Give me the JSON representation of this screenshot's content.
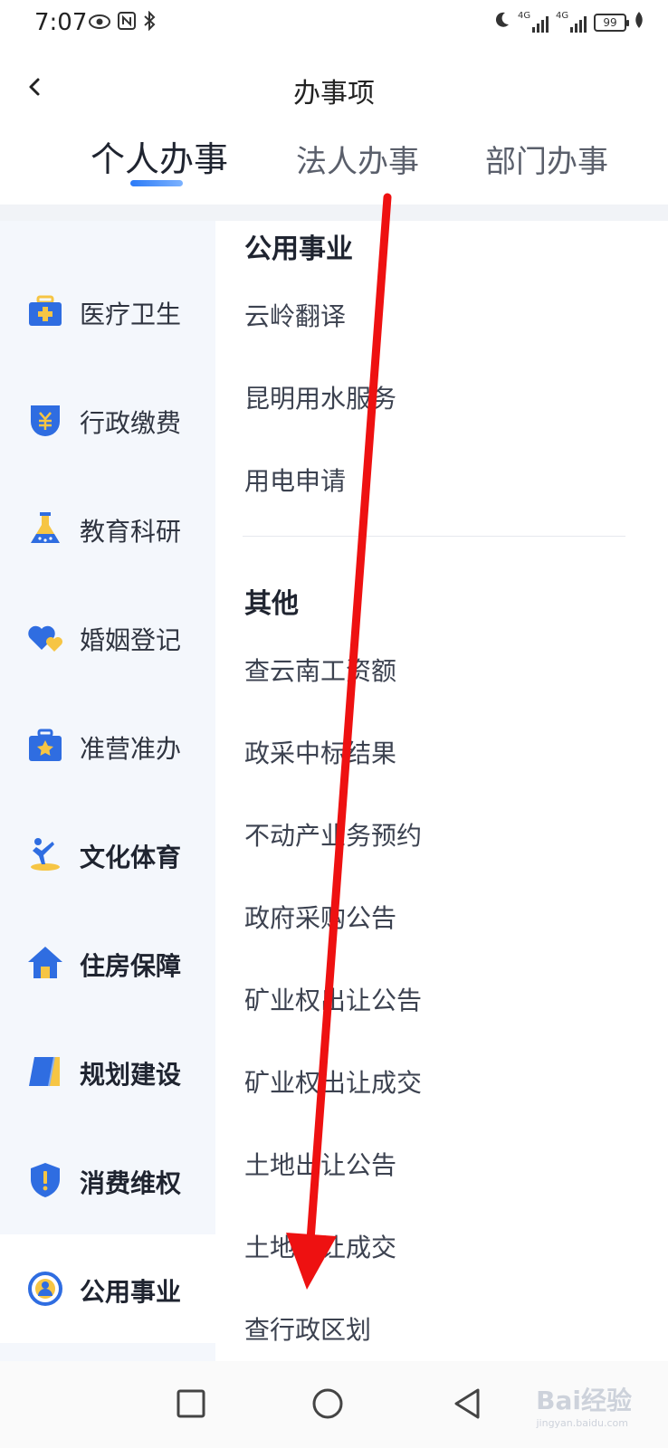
{
  "status_bar": {
    "time": "7:07",
    "left_icons": [
      "eye-icon",
      "nfc-icon",
      "bluetooth-icon"
    ],
    "right_icons": [
      "moon-icon",
      "signal-4g-icon",
      "signal-4g-icon",
      "battery-icon",
      "leaf-icon"
    ],
    "network_label": "4G",
    "battery": "99"
  },
  "header": {
    "title": "办事项",
    "back_icon": "back-chevron-icon"
  },
  "tabs": [
    {
      "label": "个人办事",
      "active": true
    },
    {
      "label": "法人办事",
      "active": false
    },
    {
      "label": "部门办事",
      "active": false
    }
  ],
  "sidebar": {
    "items": [
      {
        "label": "医疗卫生",
        "icon": "medical-kit-icon"
      },
      {
        "label": "行政缴费",
        "icon": "yuan-shield-icon"
      },
      {
        "label": "教育科研",
        "icon": "flask-icon"
      },
      {
        "label": "婚姻登记",
        "icon": "hearts-icon"
      },
      {
        "label": "准营准办",
        "icon": "star-briefcase-icon"
      },
      {
        "label": "文化体育",
        "icon": "athlete-icon"
      },
      {
        "label": "住房保障",
        "icon": "house-icon"
      },
      {
        "label": "规划建设",
        "icon": "blueprint-icon"
      },
      {
        "label": "消费维权",
        "icon": "alert-shield-icon"
      },
      {
        "label": "公用事业",
        "icon": "public-utility-icon",
        "active": true
      }
    ]
  },
  "content": {
    "sections": [
      {
        "title": "公用事业",
        "items": [
          "云岭翻译",
          "昆明用水服务",
          "用电申请"
        ]
      },
      {
        "title": "其他",
        "items": [
          "查云南工资额",
          "政采中标结果",
          "不动产业务预约",
          "政府采购公告",
          "矿业权出让公告",
          "矿业权出让成交",
          "土地出让公告",
          "土地出让成交",
          "查行政区划"
        ]
      }
    ]
  },
  "nav_bar": {
    "recent_icon": "square-recent-icon",
    "home_icon": "circle-home-icon",
    "back_icon": "triangle-back-icon"
  },
  "watermark": {
    "text": "Bai经验",
    "sub": "jingyan.baidu.com"
  },
  "colors": {
    "accent": "#2c7bf7",
    "icon_blue": "#2f6de1",
    "icon_yellow": "#f6c544",
    "arrow": "#ee1111"
  }
}
